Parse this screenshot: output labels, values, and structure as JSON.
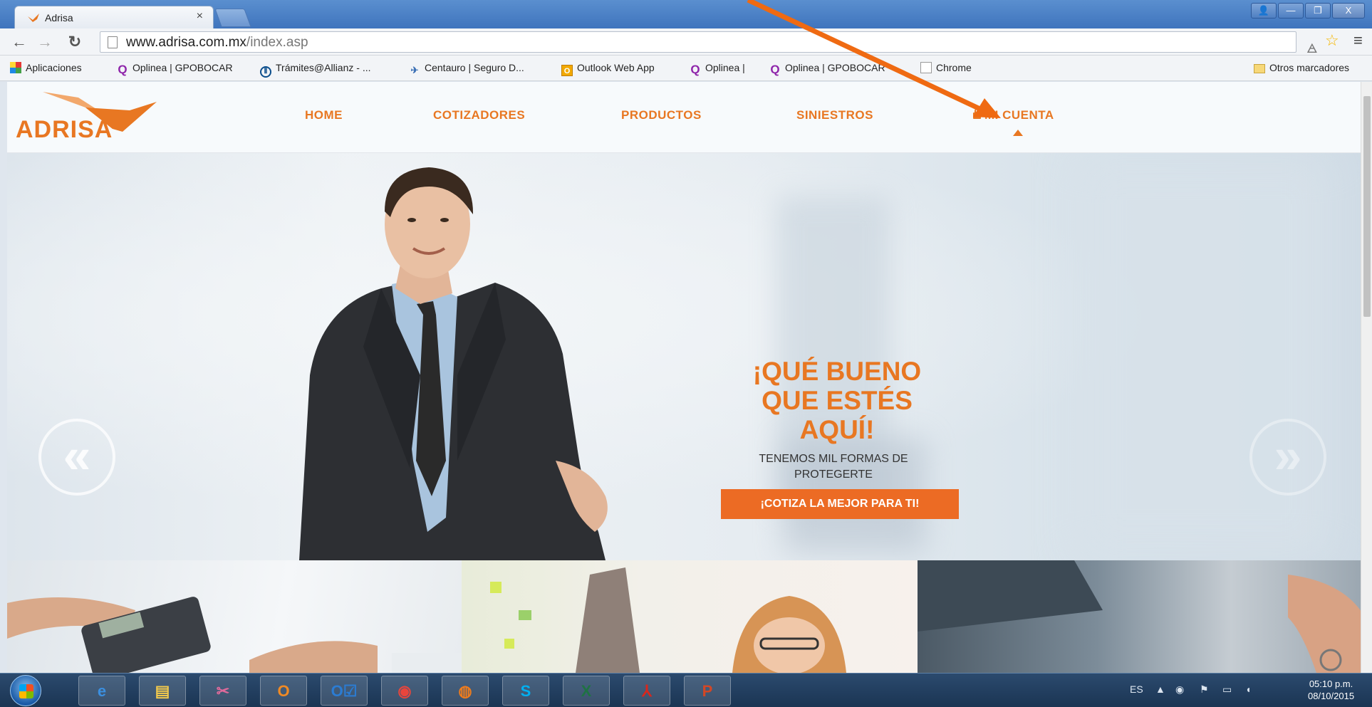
{
  "browser": {
    "tab_title": "Adrisa",
    "tab_close": "×",
    "url_host": "www.adrisa.com.mx",
    "url_path": "/index.asp",
    "window_buttons": [
      "—",
      "❐",
      "X"
    ],
    "bookmarks": [
      {
        "label": "Aplicaciones",
        "icon": "apps-icon"
      },
      {
        "label": "Oplinea | GPOBOCAR",
        "icon": "oplinea-icon"
      },
      {
        "label": "Trámites@Allianz - ...",
        "icon": "allianz-icon"
      },
      {
        "label": "Centauro | Seguro D...",
        "icon": "centauro-icon"
      },
      {
        "label": "Outlook Web App",
        "icon": "outlook-icon"
      },
      {
        "label": "Oplinea |",
        "icon": "oplinea-icon"
      },
      {
        "label": "Oplinea | GPOBOCAR",
        "icon": "oplinea-icon"
      },
      {
        "label": "Chrome",
        "icon": "page-icon"
      }
    ],
    "other_bookmarks": "Otros marcadores"
  },
  "site": {
    "logo_text": "ADRISA",
    "nav": {
      "home": "HOME",
      "cotizadores": "COTIZADORES",
      "productos": "PRODUCTOS",
      "siniestros": "SINIESTROS",
      "mi_cuenta": "MI CUENTA"
    },
    "brand_color": "#e87722",
    "hero": {
      "headline_line1": "¡QUÉ BUENO",
      "headline_line2": "QUE ESTÉS",
      "headline_line3": "AQUÍ!",
      "sub_line1": "TENEMOS MIL FORMAS DE",
      "sub_line2": "PROTEGERTE",
      "cta": "¡COTIZA LA MEJOR PARA TI!",
      "prev": "«",
      "next": "»"
    }
  },
  "taskbar": {
    "apps": [
      {
        "name": "internet-explorer",
        "glyph": "e",
        "color": "#3b8fe0"
      },
      {
        "name": "file-explorer",
        "glyph": "▤",
        "color": "#f2c94c"
      },
      {
        "name": "snipping-tool",
        "glyph": "✂",
        "color": "#e06a9b"
      },
      {
        "name": "outlook-o",
        "glyph": "O",
        "color": "#f08a24"
      },
      {
        "name": "outlook",
        "glyph": "O☑",
        "color": "#2b7cd3"
      },
      {
        "name": "chrome",
        "glyph": "◉",
        "color": "#e8453c"
      },
      {
        "name": "firefox",
        "glyph": "◍",
        "color": "#f07c1c"
      },
      {
        "name": "skype",
        "glyph": "S",
        "color": "#00aff0"
      },
      {
        "name": "excel",
        "glyph": "X",
        "color": "#1f7244"
      },
      {
        "name": "acrobat",
        "glyph": "⅄",
        "color": "#d9261c"
      },
      {
        "name": "powerpoint",
        "glyph": "P",
        "color": "#d24726"
      }
    ],
    "lang": "ES",
    "time": "05:10 p.m.",
    "date": "08/10/2015"
  }
}
